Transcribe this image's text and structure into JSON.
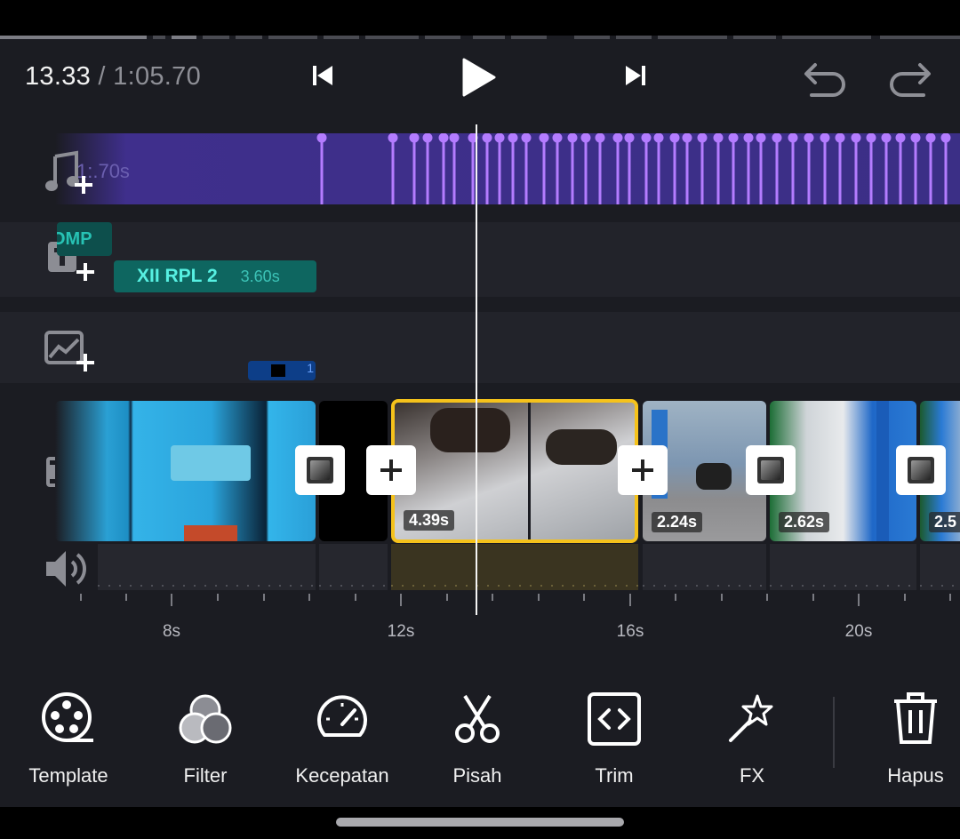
{
  "header": {
    "current_time": "13.33",
    "separator": " / ",
    "total_time": "1:05.70"
  },
  "controls": {
    "prev_label": "skip-previous-icon",
    "play_label": "play-icon",
    "next_label": "skip-next-icon",
    "undo_label": "undo-icon",
    "redo_label": "redo-icon"
  },
  "tracks": {
    "music": {
      "icon": "music-add-icon",
      "ghost_label": "1:.70s"
    },
    "text": {
      "icon": "text-add-icon",
      "ghost_clip": "OMP",
      "clip_name": "XII RPL 2",
      "clip_duration": "3.60s"
    },
    "sticker": {
      "icon": "image-add-icon",
      "clip_number": "1"
    },
    "video": {
      "icon": "video-add-icon"
    },
    "audio": {
      "icon": "volume-icon"
    }
  },
  "clips": [
    {
      "duration": "4.39s"
    },
    {
      "duration": "2.24s"
    },
    {
      "duration": "2.62s"
    },
    {
      "duration": "2.5"
    }
  ],
  "ruler": {
    "labels": [
      "8s",
      "12s",
      "16s",
      "20s"
    ]
  },
  "toolbar": {
    "items": [
      {
        "label": "Template",
        "icon": "film-reel-icon"
      },
      {
        "label": "Filter",
        "icon": "filter-circles-icon"
      },
      {
        "label": "Kecepatan",
        "icon": "speedometer-icon"
      },
      {
        "label": "Pisah",
        "icon": "scissors-icon"
      },
      {
        "label": "Trim",
        "icon": "trim-icon"
      },
      {
        "label": "FX",
        "icon": "magic-wand-icon"
      },
      {
        "label": "Hapus",
        "icon": "trash-icon"
      }
    ]
  },
  "colors": {
    "background": "#1b1c22",
    "music_track": "#3f2f8c",
    "beat_marker": "#b47cff",
    "text_clip": "#0e6660",
    "text_clip_label": "#57f0e2",
    "selected_border": "#f5c21b",
    "playhead": "#f4f4f4"
  }
}
